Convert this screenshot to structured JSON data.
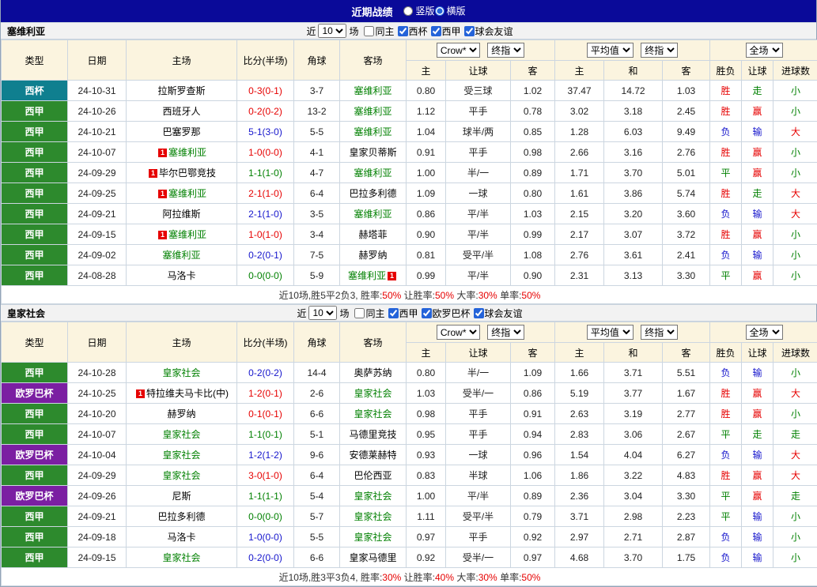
{
  "colors": {
    "red": "#e60000",
    "green": "#008000",
    "blue": "#1515cc",
    "navy": "#0a0a99",
    "liga_green": "#2d8a2d",
    "cup_teal": "#0f7f8f",
    "europa_purple": "#7b1fa2",
    "header_cream": "#fbf4df"
  },
  "top_bar": {
    "title": "近期战绩",
    "radios": [
      {
        "label": "竖版",
        "checked": false
      },
      {
        "label": "横版",
        "checked": true
      }
    ]
  },
  "header_labels": {
    "static": [
      "类型",
      "日期",
      "主场",
      "比分(半场)",
      "角球",
      "客场"
    ],
    "group1_selects": [
      "Crow*",
      "终指"
    ],
    "group1_cols": [
      "主",
      "让球",
      "客"
    ],
    "group2_selects": [
      "平均值",
      "终指"
    ],
    "group2_cols": [
      "主",
      "和",
      "客"
    ],
    "group3_selects": [
      "全场"
    ],
    "group3_cols": [
      "胜负",
      "让球",
      "进球数"
    ]
  },
  "sections": [
    {
      "team": "塞维利亚",
      "filter": {
        "prefix": "近",
        "count": "10",
        "suffix": "场",
        "checks": [
          {
            "label": "同主",
            "checked": false
          },
          {
            "label": "西杯",
            "checked": true
          },
          {
            "label": "西甲",
            "checked": true
          },
          {
            "label": "球会友谊",
            "checked": true
          }
        ]
      },
      "rows": [
        {
          "type": "西杯",
          "tk": "cup",
          "date": "24-10-31",
          "home": {
            "n": "拉斯罗查斯"
          },
          "score": "0-3(0-1)",
          "corner": "3-7",
          "away": {
            "n": "塞维利亚",
            "f": 1
          },
          "odds": [
            "0.80",
            "受三球",
            "1.02",
            "37.47",
            "14.72",
            "1.03"
          ],
          "res": [
            "胜",
            "走",
            "小"
          ]
        },
        {
          "type": "西甲",
          "tk": "liga",
          "date": "24-10-26",
          "home": {
            "n": "西班牙人"
          },
          "score": "0-2(0-2)",
          "corner": "13-2",
          "away": {
            "n": "塞维利亚",
            "f": 1
          },
          "odds": [
            "1.12",
            "平手",
            "0.78",
            "3.02",
            "3.18",
            "2.45"
          ],
          "res": [
            "胜",
            "赢",
            "小"
          ]
        },
        {
          "type": "西甲",
          "tk": "liga",
          "date": "24-10-21",
          "home": {
            "n": "巴塞罗那"
          },
          "score": "5-1(3-0)",
          "corner": "5-5",
          "away": {
            "n": "塞维利亚",
            "f": 1
          },
          "odds": [
            "1.04",
            "球半/两",
            "0.85",
            "1.28",
            "6.03",
            "9.49"
          ],
          "res": [
            "负",
            "输",
            "大"
          ]
        },
        {
          "type": "西甲",
          "tk": "liga",
          "date": "24-10-07",
          "home": {
            "n": "塞维利亚",
            "f": 1,
            "b": "l"
          },
          "score": "1-0(0-0)",
          "corner": "4-1",
          "away": {
            "n": "皇家贝蒂斯"
          },
          "odds": [
            "0.91",
            "平手",
            "0.98",
            "2.66",
            "3.16",
            "2.76"
          ],
          "res": [
            "胜",
            "赢",
            "小"
          ]
        },
        {
          "type": "西甲",
          "tk": "liga",
          "date": "24-09-29",
          "home": {
            "n": "毕尔巴鄂竞技",
            "b": "l"
          },
          "score": "1-1(1-0)",
          "corner": "4-7",
          "away": {
            "n": "塞维利亚",
            "f": 1
          },
          "odds": [
            "1.00",
            "半/一",
            "0.89",
            "1.71",
            "3.70",
            "5.01"
          ],
          "res": [
            "平",
            "赢",
            "小"
          ]
        },
        {
          "type": "西甲",
          "tk": "liga",
          "date": "24-09-25",
          "home": {
            "n": "塞维利亚",
            "f": 1,
            "b": "l"
          },
          "score": "2-1(1-0)",
          "corner": "6-4",
          "away": {
            "n": "巴拉多利德"
          },
          "odds": [
            "1.09",
            "一球",
            "0.80",
            "1.61",
            "3.86",
            "5.74"
          ],
          "res": [
            "胜",
            "走",
            "大"
          ]
        },
        {
          "type": "西甲",
          "tk": "liga",
          "date": "24-09-21",
          "home": {
            "n": "阿拉维斯"
          },
          "score": "2-1(1-0)",
          "corner": "3-5",
          "away": {
            "n": "塞维利亚",
            "f": 1
          },
          "odds": [
            "0.86",
            "平/半",
            "1.03",
            "2.15",
            "3.20",
            "3.60"
          ],
          "res": [
            "负",
            "输",
            "大"
          ]
        },
        {
          "type": "西甲",
          "tk": "liga",
          "date": "24-09-15",
          "home": {
            "n": "塞维利亚",
            "f": 1,
            "b": "l"
          },
          "score": "1-0(1-0)",
          "corner": "3-4",
          "away": {
            "n": "赫塔菲"
          },
          "odds": [
            "0.90",
            "平/半",
            "0.99",
            "2.17",
            "3.07",
            "3.72"
          ],
          "res": [
            "胜",
            "赢",
            "小"
          ]
        },
        {
          "type": "西甲",
          "tk": "liga",
          "date": "24-09-02",
          "home": {
            "n": "塞维利亚",
            "f": 1
          },
          "score": "0-2(0-1)",
          "corner": "7-5",
          "away": {
            "n": "赫罗纳"
          },
          "odds": [
            "0.81",
            "受平/半",
            "1.08",
            "2.76",
            "3.61",
            "2.41"
          ],
          "res": [
            "负",
            "输",
            "小"
          ]
        },
        {
          "type": "西甲",
          "tk": "liga",
          "date": "24-08-28",
          "home": {
            "n": "马洛卡"
          },
          "score": "0-0(0-0)",
          "corner": "5-9",
          "away": {
            "n": "塞维利亚",
            "f": 1,
            "b": "r"
          },
          "odds": [
            "0.99",
            "平/半",
            "0.90",
            "2.31",
            "3.13",
            "3.30"
          ],
          "res": [
            "平",
            "赢",
            "小"
          ]
        }
      ],
      "summary": [
        {
          "t": "近10场,胜5平2负3, "
        },
        {
          "t": "胜率:"
        },
        {
          "t": "50%",
          "red": true
        },
        {
          "t": " 让胜率:"
        },
        {
          "t": "50%",
          "red": true
        },
        {
          "t": " 大率:"
        },
        {
          "t": "30%",
          "red": true
        },
        {
          "t": " 单率:"
        },
        {
          "t": "50%",
          "red": true
        }
      ]
    },
    {
      "team": "皇家社会",
      "filter": {
        "prefix": "近",
        "count": "10",
        "suffix": "场",
        "checks": [
          {
            "label": "同主",
            "checked": false
          },
          {
            "label": "西甲",
            "checked": true
          },
          {
            "label": "欧罗巴杯",
            "checked": true
          },
          {
            "label": "球会友谊",
            "checked": true
          }
        ]
      },
      "rows": [
        {
          "type": "西甲",
          "tk": "liga",
          "date": "24-10-28",
          "home": {
            "n": "皇家社会",
            "f": 1
          },
          "score": "0-2(0-2)",
          "corner": "14-4",
          "away": {
            "n": "奥萨苏纳"
          },
          "odds": [
            "0.80",
            "半/一",
            "1.09",
            "1.66",
            "3.71",
            "5.51"
          ],
          "res": [
            "负",
            "输",
            "小"
          ]
        },
        {
          "type": "欧罗巴杯",
          "tk": "europa",
          "date": "24-10-25",
          "home": {
            "n": "特拉维夫马卡比(中)",
            "b": "l"
          },
          "score": "1-2(0-1)",
          "corner": "2-6",
          "away": {
            "n": "皇家社会",
            "f": 1
          },
          "odds": [
            "1.03",
            "受半/一",
            "0.86",
            "5.19",
            "3.77",
            "1.67"
          ],
          "res": [
            "胜",
            "赢",
            "大"
          ]
        },
        {
          "type": "西甲",
          "tk": "liga",
          "date": "24-10-20",
          "home": {
            "n": "赫罗纳"
          },
          "score": "0-1(0-1)",
          "corner": "6-6",
          "away": {
            "n": "皇家社会",
            "f": 1
          },
          "odds": [
            "0.98",
            "平手",
            "0.91",
            "2.63",
            "3.19",
            "2.77"
          ],
          "res": [
            "胜",
            "赢",
            "小"
          ]
        },
        {
          "type": "西甲",
          "tk": "liga",
          "date": "24-10-07",
          "home": {
            "n": "皇家社会",
            "f": 1
          },
          "score": "1-1(0-1)",
          "corner": "5-1",
          "away": {
            "n": "马德里竞技"
          },
          "odds": [
            "0.95",
            "平手",
            "0.94",
            "2.83",
            "3.06",
            "2.67"
          ],
          "res": [
            "平",
            "走",
            "走"
          ]
        },
        {
          "type": "欧罗巴杯",
          "tk": "europa",
          "date": "24-10-04",
          "home": {
            "n": "皇家社会",
            "f": 1
          },
          "score": "1-2(1-2)",
          "corner": "9-6",
          "away": {
            "n": "安德莱赫特"
          },
          "odds": [
            "0.93",
            "一球",
            "0.96",
            "1.54",
            "4.04",
            "6.27"
          ],
          "res": [
            "负",
            "输",
            "大"
          ]
        },
        {
          "type": "西甲",
          "tk": "liga",
          "date": "24-09-29",
          "home": {
            "n": "皇家社会",
            "f": 1
          },
          "score": "3-0(1-0)",
          "corner": "6-4",
          "away": {
            "n": "巴伦西亚"
          },
          "odds": [
            "0.83",
            "半球",
            "1.06",
            "1.86",
            "3.22",
            "4.83"
          ],
          "res": [
            "胜",
            "赢",
            "大"
          ]
        },
        {
          "type": "欧罗巴杯",
          "tk": "europa",
          "date": "24-09-26",
          "home": {
            "n": "尼斯"
          },
          "score": "1-1(1-1)",
          "corner": "5-4",
          "away": {
            "n": "皇家社会",
            "f": 1
          },
          "odds": [
            "1.00",
            "平/半",
            "0.89",
            "2.36",
            "3.04",
            "3.30"
          ],
          "res": [
            "平",
            "赢",
            "走"
          ]
        },
        {
          "type": "西甲",
          "tk": "liga",
          "date": "24-09-21",
          "home": {
            "n": "巴拉多利德"
          },
          "score": "0-0(0-0)",
          "corner": "5-7",
          "away": {
            "n": "皇家社会",
            "f": 1
          },
          "odds": [
            "1.11",
            "受平/半",
            "0.79",
            "3.71",
            "2.98",
            "2.23"
          ],
          "res": [
            "平",
            "输",
            "小"
          ]
        },
        {
          "type": "西甲",
          "tk": "liga",
          "date": "24-09-18",
          "home": {
            "n": "马洛卡"
          },
          "score": "1-0(0-0)",
          "corner": "5-5",
          "away": {
            "n": "皇家社会",
            "f": 1
          },
          "odds": [
            "0.97",
            "平手",
            "0.92",
            "2.97",
            "2.71",
            "2.87"
          ],
          "res": [
            "负",
            "输",
            "小"
          ]
        },
        {
          "type": "西甲",
          "tk": "liga",
          "date": "24-09-15",
          "home": {
            "n": "皇家社会",
            "f": 1
          },
          "score": "0-2(0-0)",
          "corner": "6-6",
          "away": {
            "n": "皇家马德里"
          },
          "odds": [
            "0.92",
            "受半/一",
            "0.97",
            "4.68",
            "3.70",
            "1.75"
          ],
          "res": [
            "负",
            "输",
            "小"
          ]
        }
      ],
      "summary": [
        {
          "t": "近10场,胜3平3负4, "
        },
        {
          "t": "胜率:"
        },
        {
          "t": "30%",
          "red": true
        },
        {
          "t": " 让胜率:"
        },
        {
          "t": "40%",
          "red": true
        },
        {
          "t": " 大率:"
        },
        {
          "t": "30%",
          "red": true
        },
        {
          "t": " 单率:"
        },
        {
          "t": "50%",
          "red": true
        }
      ]
    }
  ]
}
